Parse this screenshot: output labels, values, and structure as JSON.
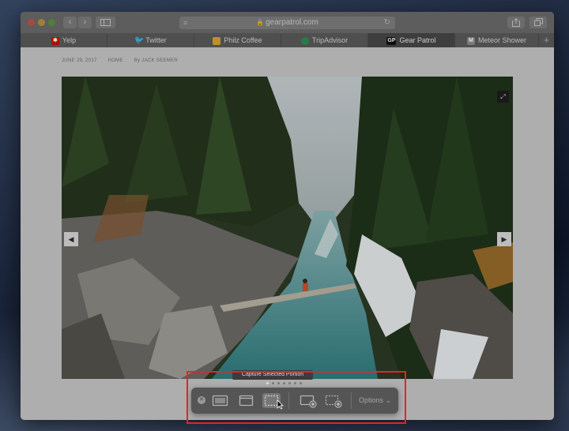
{
  "window": {
    "address": "gearpatrol.com"
  },
  "tabs": [
    {
      "label": "Yelp",
      "icon": "yelp-icon",
      "color": "#c41200"
    },
    {
      "label": "Twitter",
      "icon": "twitter-icon",
      "color": "#1da1f2"
    },
    {
      "label": "Philz Coffee",
      "icon": "philz-coffee-icon",
      "color": "#d8a23a"
    },
    {
      "label": "TripAdvisor",
      "icon": "tripadvisor-icon",
      "color": "#2d8c54"
    },
    {
      "label": "Gear Patrol",
      "icon": "gear-patrol-icon",
      "color": "#111111",
      "active": true
    },
    {
      "label": "Meteor Shower",
      "icon": "meteor-shower-icon",
      "color": "#8a8a8a"
    }
  ],
  "favicon_letters": {
    "gear_patrol": "GP",
    "meteor_shower": "M"
  },
  "article": {
    "date": "JUNE 29, 2017",
    "section": "HOME",
    "byline": "By JACK SEEMER"
  },
  "screenshot_toolbar": {
    "tooltip": "Capture Selected Portion",
    "options_label": "Options",
    "buttons": [
      "close-screenshot-icon",
      "capture-entire-screen-icon",
      "capture-selected-window-icon",
      "capture-selected-portion-icon",
      "record-entire-screen-icon",
      "record-selected-portion-icon"
    ],
    "page_indicator": {
      "count": 7,
      "current": 1
    }
  },
  "colors": {
    "highlight": "#e02626",
    "toolbar": "#555555"
  }
}
